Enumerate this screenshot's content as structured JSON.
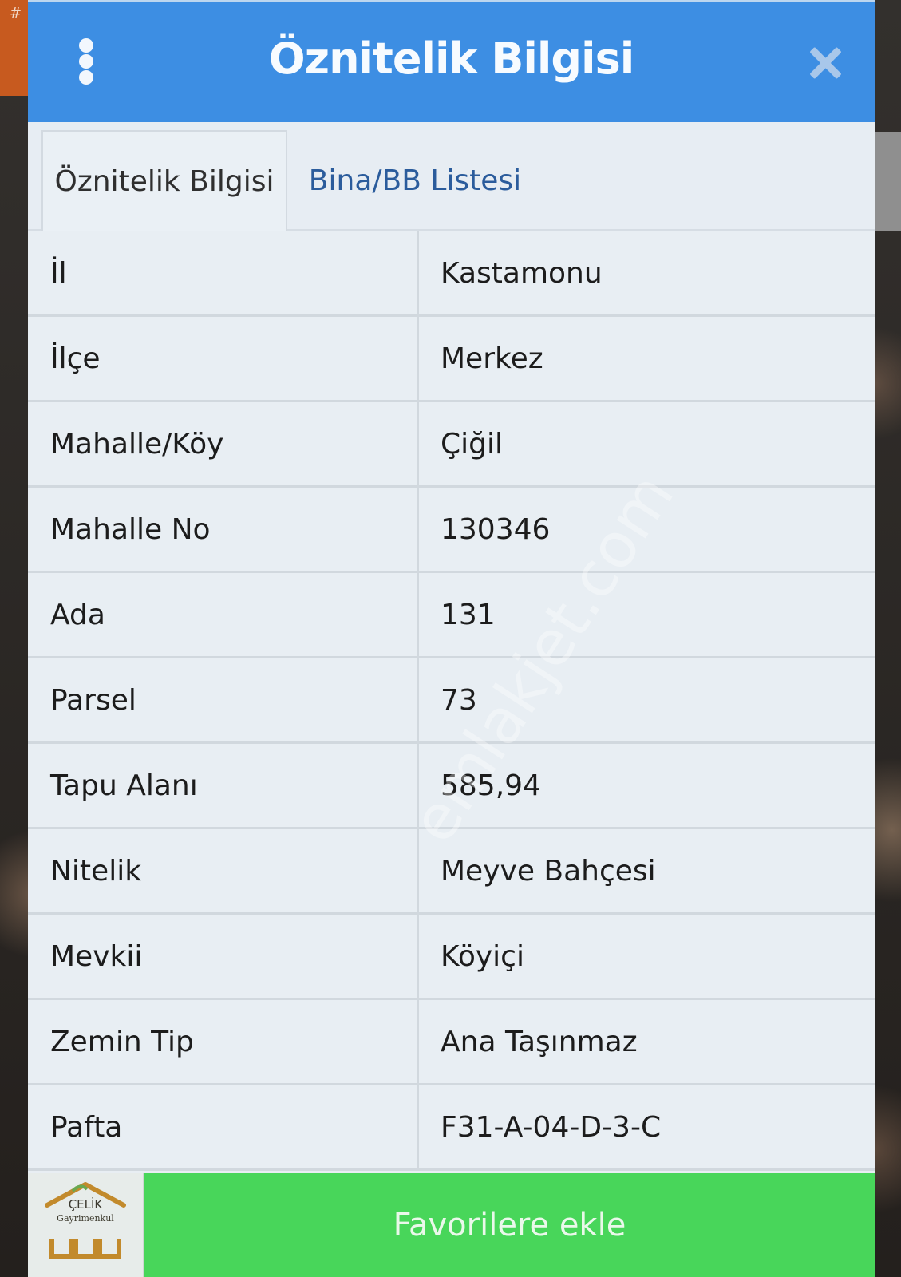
{
  "dialog": {
    "title": "Öznitelik Bilgisi",
    "menu_icon": "more-vertical-icon",
    "close_icon": "close-icon"
  },
  "tabs": [
    {
      "label": "Öznitelik Bilgisi",
      "active": true
    },
    {
      "label": "Bina/BB Listesi",
      "active": false
    }
  ],
  "attributes": [
    {
      "key": "İl",
      "value": "Kastamonu"
    },
    {
      "key": "İlçe",
      "value": "Merkez"
    },
    {
      "key": "Mahalle/Köy",
      "value": "Çiğil"
    },
    {
      "key": "Mahalle No",
      "value": "130346"
    },
    {
      "key": "Ada",
      "value": "131"
    },
    {
      "key": "Parsel",
      "value": "73"
    },
    {
      "key": "Tapu Alanı",
      "value": "585,94"
    },
    {
      "key": "Nitelik",
      "value": "Meyve Bahçesi"
    },
    {
      "key": "Mevkii",
      "value": "Köyiçi"
    },
    {
      "key": "Zemin Tip",
      "value": "Ana Taşınmaz"
    },
    {
      "key": "Pafta",
      "value": "F31-A-04-D-3-C"
    }
  ],
  "footer": {
    "button_label": "Favorilere ekle",
    "logo_name": "ÇELİK",
    "logo_sub": "Gayrimenkul"
  },
  "background": {
    "corner_text": "#"
  },
  "watermark": "emlakjet.com",
  "colors": {
    "header": "#3d8ee3",
    "footer": "#48d65a",
    "tab_link": "#2b5c9c",
    "panel": "#e8eef3"
  }
}
